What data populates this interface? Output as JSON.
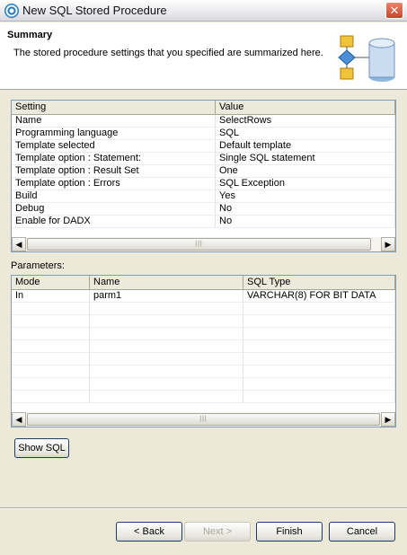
{
  "window": {
    "title": "New SQL Stored Procedure",
    "close_label": "✕"
  },
  "header": {
    "title": "Summary",
    "description": "The stored procedure settings that you specified are summarized here."
  },
  "settings_table": {
    "columns": [
      "Setting",
      "Value"
    ],
    "rows": [
      [
        "Name",
        "SelectRows"
      ],
      [
        "Programming language",
        "SQL"
      ],
      [
        "Template selected",
        "Default template"
      ],
      [
        "Template option : Statement:",
        "Single SQL statement"
      ],
      [
        "Template option : Result Set",
        "One"
      ],
      [
        "Template option : Errors",
        "SQL Exception"
      ],
      [
        "Build",
        "Yes"
      ],
      [
        "Debug",
        "No"
      ],
      [
        "Enable for DADX",
        "No"
      ]
    ]
  },
  "parameters": {
    "label": "Parameters:",
    "columns": [
      "Mode",
      "Name",
      "SQL Type"
    ],
    "rows": [
      [
        "In",
        "parm1",
        "VARCHAR(8) FOR BIT DATA"
      ]
    ]
  },
  "buttons": {
    "show_sql": "Show SQL",
    "back": "< Back",
    "next": "Next >",
    "finish": "Finish",
    "cancel": "Cancel"
  },
  "scroll": {
    "left_arrow": "◀",
    "right_arrow": "▶",
    "thumb_grip": "|||"
  }
}
